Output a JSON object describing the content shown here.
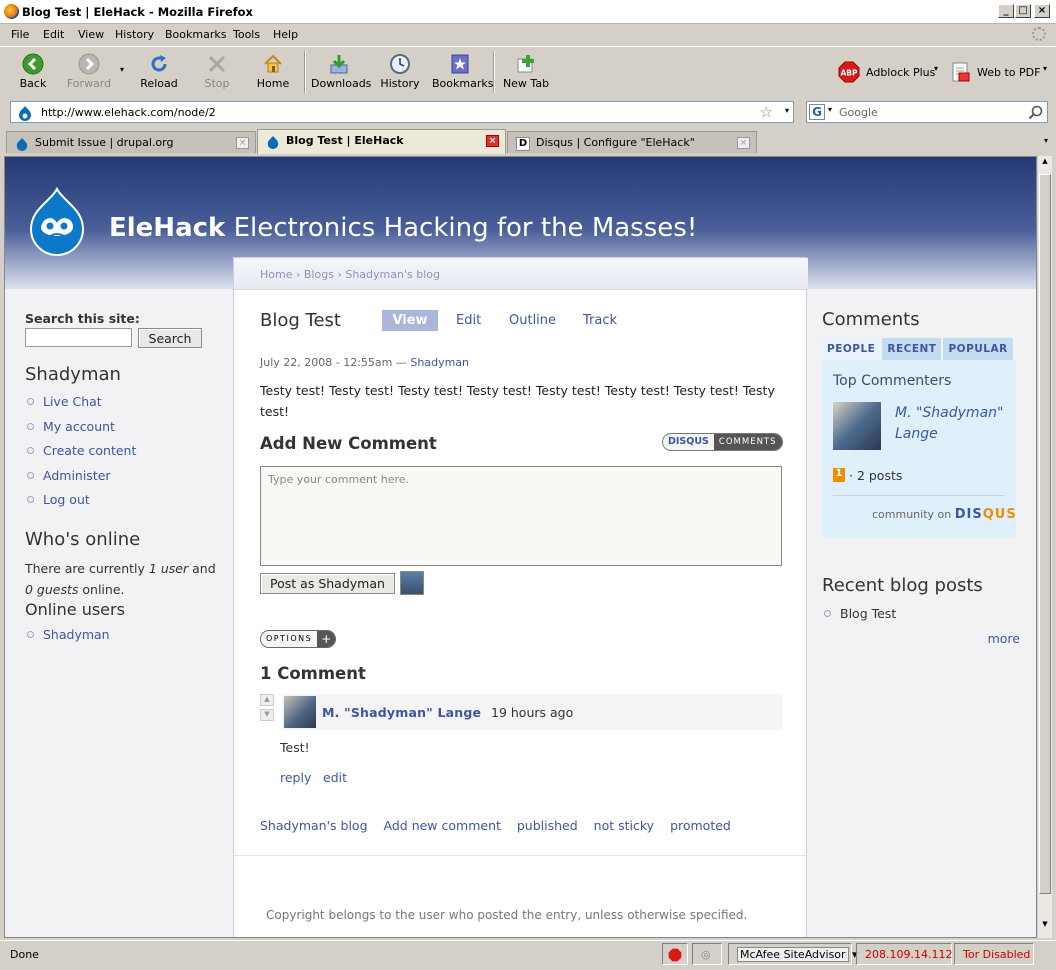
{
  "window": {
    "title": "Blog Test | EleHack - Mozilla Firefox"
  },
  "menu": [
    "File",
    "Edit",
    "View",
    "History",
    "Bookmarks",
    "Tools",
    "Help"
  ],
  "toolbar": {
    "back": "Back",
    "forward": "Forward",
    "reload": "Reload",
    "stop": "Stop",
    "home": "Home",
    "downloads": "Downloads",
    "history": "History",
    "bookmarks": "Bookmarks",
    "newtab": "New Tab",
    "adblock": "Adblock Plus",
    "webtopdf": "Web to PDF"
  },
  "address": {
    "url": "http://www.elehack.com/node/2",
    "search_placeholder": "Google"
  },
  "tabs": [
    {
      "label": "Submit Issue | drupal.org"
    },
    {
      "label": "Blog Test | EleHack"
    },
    {
      "label": "Disqus | Configure \"EleHack\""
    }
  ],
  "site": {
    "name_bold": "EleHack",
    "slogan": "Electronics Hacking for the Masses!"
  },
  "breadcrumb": {
    "home": "Home",
    "blogs": "Blogs",
    "blog": "Shadyman's blog",
    "sep": "›"
  },
  "left": {
    "search_label": "Search this site:",
    "search_button": "Search",
    "user_title": "Shadyman",
    "user_links": [
      "Live Chat",
      "My account",
      "Create content",
      "Administer",
      "Log out"
    ],
    "whos_online_title": "Who's online",
    "online_text_1": "There are currently",
    "online_users_count": "1 user",
    "online_text_2": "and",
    "online_guests": "0 guests",
    "online_text_3": "online.",
    "online_users_title": "Online users",
    "online_users": [
      "Shadyman"
    ]
  },
  "node": {
    "title": "Blog Test",
    "tabs": [
      "View",
      "Edit",
      "Outline",
      "Track"
    ],
    "meta_date": "July 22, 2008 - 12:55am —",
    "meta_author": "Shadyman",
    "body": "Testy test! Testy test! Testy test! Testy test! Testy test! Testy test! Testy test! Testy test!",
    "links": [
      "Shadyman's blog",
      "Add new comment",
      "published",
      "not sticky",
      "promoted"
    ]
  },
  "comments": {
    "add_title": "Add New Comment",
    "disqus_badge_1": "DISQUS",
    "disqus_badge_2": "COMMENTS",
    "placeholder": "Type your comment here.",
    "post_button": "Post as Shadyman",
    "options_label": "OPTIONS",
    "options_plus": "+",
    "count_title": "1 Comment",
    "items": [
      {
        "author": "M. \"Shadyman\" Lange",
        "time": "19 hours ago",
        "text": "Test!",
        "reply": "reply",
        "edit": "edit"
      }
    ]
  },
  "right": {
    "comments_title": "Comments",
    "tabs": [
      "PEOPLE",
      "RECENT",
      "POPULAR"
    ],
    "top_commenters": "Top Commenters",
    "commenter_name": "M. \"Shadyman\" Lange",
    "commenter_rank": "1",
    "commenter_posts": "· 2 posts",
    "community_on": "community on",
    "disqus_1": "DIS",
    "disqus_2": "QUS",
    "recent_title": "Recent blog posts",
    "recent_posts": [
      "Blog Test"
    ],
    "more": "more"
  },
  "footer": {
    "text": "Copyright belongs to the user who posted the entry, unless otherwise specified."
  },
  "status": {
    "left": "Done",
    "siteadvisor": "McAfee SiteAdvisor",
    "ip": "208.109.14.112",
    "tor": "Tor Disabled"
  },
  "colors": {
    "link": "#3e56a0",
    "header_dark": "#233a74",
    "active_tab_blue": "#aab6da",
    "disqus_orange": "#f08c00"
  }
}
